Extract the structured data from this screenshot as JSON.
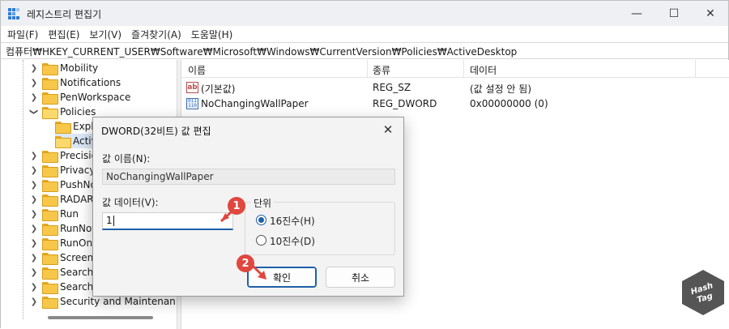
{
  "window": {
    "title": "레지스트리 편집기",
    "minimize_glyph": "—",
    "maximize_glyph": "☐",
    "close_glyph": "✕"
  },
  "menu": [
    "파일(F)",
    "편집(E)",
    "보기(V)",
    "즐겨찾기(A)",
    "도움말(H)"
  ],
  "address": "컴퓨터₩HKEY_CURRENT_USER₩Software₩Microsoft₩Windows₩CurrentVersion₩Policies₩ActiveDesktop",
  "tree": {
    "items": [
      {
        "label": "Mobility",
        "state": "collapsed"
      },
      {
        "label": "Notifications",
        "state": "collapsed"
      },
      {
        "label": "PenWorkspace",
        "state": "collapsed"
      },
      {
        "label": "Policies",
        "state": "expanded"
      },
      {
        "label": "Explo",
        "state": "child"
      },
      {
        "label": "Activ",
        "state": "child-selected"
      },
      {
        "label": "Precision",
        "state": "collapsed"
      },
      {
        "label": "Privacy",
        "state": "collapsed"
      },
      {
        "label": "PushNo",
        "state": "collapsed"
      },
      {
        "label": "RADAR",
        "state": "collapsed"
      },
      {
        "label": "Run",
        "state": "collapsed"
      },
      {
        "label": "RunNoti",
        "state": "collapsed"
      },
      {
        "label": "RunOnc",
        "state": "collapsed"
      },
      {
        "label": "Screensa",
        "state": "collapsed"
      },
      {
        "label": "Search",
        "state": "collapsed"
      },
      {
        "label": "SearchS",
        "state": "collapsed"
      },
      {
        "label": "Security and Maintenan",
        "state": "collapsed"
      }
    ]
  },
  "list": {
    "headers": {
      "name": "이름",
      "type": "종류",
      "data": "데이터"
    },
    "rows": [
      {
        "icon": "string-value-icon",
        "icon_text": "ab",
        "name": "(기본값)",
        "type": "REG_SZ",
        "data": "(값 설정 안 됨)"
      },
      {
        "icon": "binary-value-icon",
        "icon_text": "011 110",
        "name": "NoChangingWallPaper",
        "type": "REG_DWORD",
        "data": "0x00000000 (0)"
      }
    ]
  },
  "dialog": {
    "title": "DWORD(32비트) 값 편집",
    "close_glyph": "✕",
    "value_name_label": "값 이름(N):",
    "value_name": "NoChangingWallPaper",
    "value_data_label": "값 데이터(V):",
    "value_data": "1",
    "base_label": "단위",
    "base_options": [
      {
        "label": "16진수(H)",
        "checked": true
      },
      {
        "label": "10진수(D)",
        "checked": false
      }
    ],
    "ok_label": "확인",
    "cancel_label": "취소"
  },
  "markers": [
    "1",
    "2"
  ],
  "watermark": "Hash Tag",
  "colors": {
    "accent": "#1f5fa8",
    "marker": "#e0473e",
    "folder": "#f7c74a"
  }
}
